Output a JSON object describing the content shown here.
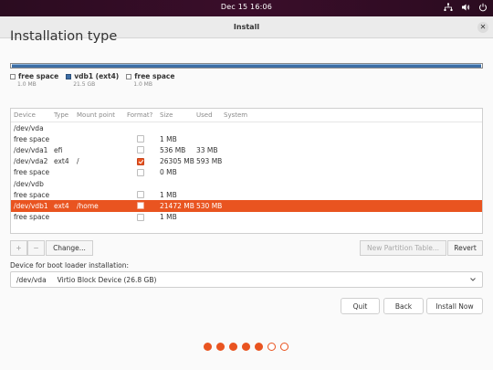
{
  "topbar": {
    "clock": "Dec 15  16:06"
  },
  "window": {
    "title": "Install"
  },
  "page": {
    "heading": "Installation type"
  },
  "legend": [
    {
      "label": "free space",
      "size": "1.0 MB",
      "kind": "free"
    },
    {
      "label": "vdb1 (ext4)",
      "size": "21.5 GB",
      "kind": "ext4"
    },
    {
      "label": "free space",
      "size": "1.0 MB",
      "kind": "free"
    }
  ],
  "table": {
    "headers": {
      "device": "Device",
      "type": "Type",
      "mount": "Mount point",
      "format": "Format?",
      "size": "Size",
      "used": "Used",
      "system": "System"
    },
    "rows": [
      {
        "device": "/dev/vda",
        "type": "",
        "mount": "",
        "format": null,
        "size": "",
        "used": "",
        "system": "",
        "group": true
      },
      {
        "device": "free space",
        "type": "",
        "mount": "",
        "format": "unchecked",
        "size": "1 MB",
        "used": "",
        "system": ""
      },
      {
        "device": "/dev/vda1",
        "type": "efi",
        "mount": "",
        "format": "unchecked",
        "size": "536 MB",
        "used": "33 MB",
        "system": ""
      },
      {
        "device": "/dev/vda2",
        "type": "ext4",
        "mount": "/",
        "format": "checked",
        "size": "26305 MB",
        "used": "593 MB",
        "system": ""
      },
      {
        "device": "free space",
        "type": "",
        "mount": "",
        "format": "unchecked",
        "size": "0 MB",
        "used": "",
        "system": ""
      },
      {
        "device": "/dev/vdb",
        "type": "",
        "mount": "",
        "format": null,
        "size": "",
        "used": "",
        "system": "",
        "group": true
      },
      {
        "device": "free space",
        "type": "",
        "mount": "",
        "format": "unchecked",
        "size": "1 MB",
        "used": "",
        "system": ""
      },
      {
        "device": "/dev/vdb1",
        "type": "ext4",
        "mount": "/home",
        "format": "unchecked",
        "size": "21472 MB",
        "used": "530 MB",
        "system": "",
        "selected": true
      },
      {
        "device": "free space",
        "type": "",
        "mount": "",
        "format": "unchecked",
        "size": "1 MB",
        "used": "",
        "system": ""
      }
    ]
  },
  "tools": {
    "add": "+",
    "remove": "−",
    "change": "Change...",
    "new_table": "New Partition Table...",
    "revert": "Revert"
  },
  "boot": {
    "label": "Device for boot loader installation:",
    "device": "/dev/vda",
    "description": "Virtio Block Device (26.8 GB)"
  },
  "nav": {
    "quit": "Quit",
    "back": "Back",
    "install": "Install Now"
  },
  "progress": {
    "total_steps": 7,
    "completed_steps": 5
  },
  "colors": {
    "accent": "#e95420",
    "ext4": "#3d6ea6",
    "topbar": "#2b0c20"
  }
}
